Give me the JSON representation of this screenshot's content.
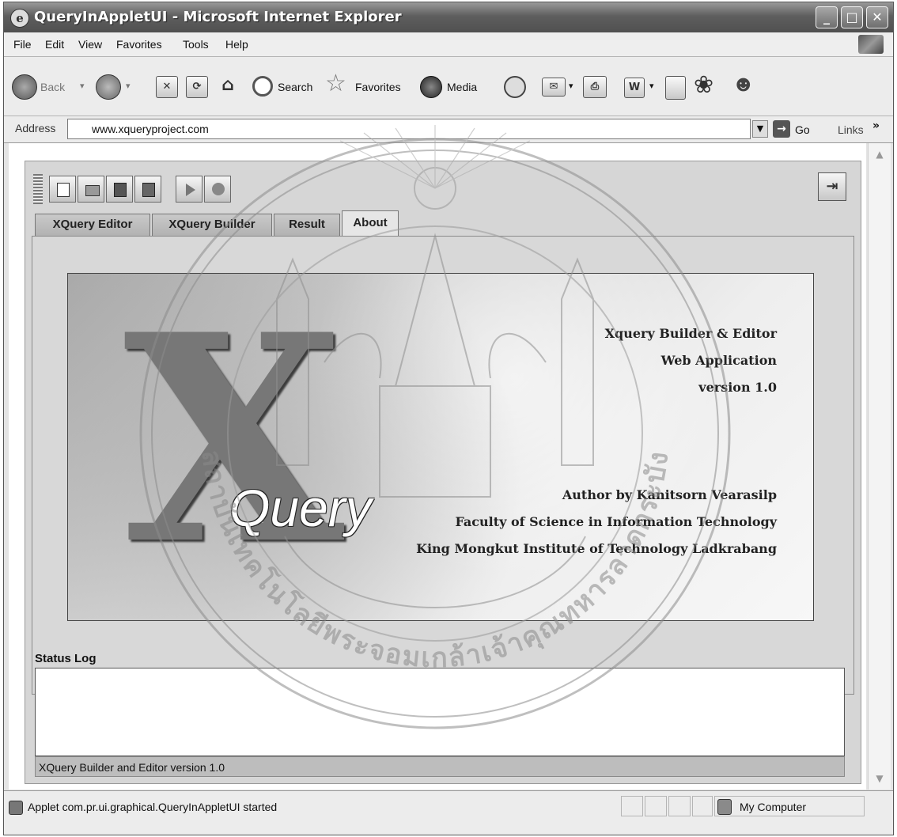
{
  "window": {
    "title": "QueryInAppletUI - Microsoft Internet Explorer",
    "controls": [
      "_",
      "□",
      "✕"
    ]
  },
  "menu": [
    "File",
    "Edit",
    "View",
    "Favorites",
    "Tools",
    "Help"
  ],
  "toolbar": {
    "back": "Back",
    "search": "Search",
    "favorites": "Favorites",
    "media": "Media"
  },
  "address": {
    "label": "Address",
    "url": "www.xqueryproject.com",
    "go": "Go",
    "links": "Links",
    "chevron": "»"
  },
  "applet": {
    "tabs": [
      "XQuery Editor",
      "XQuery Builder",
      "Result",
      "About"
    ],
    "active_tab": "About",
    "about": {
      "logo_letter": "X",
      "logo_word": "Query",
      "lines": [
        "Xquery Builder & Editor",
        "Web Application",
        "version  1.0",
        "Author by Kanitsorn Vearasilp",
        "Faculty of Science in Information Technology",
        "King Mongkut Institute of Technology Ladkrabang"
      ]
    },
    "status_log_label": "Status Log",
    "status_strip": "XQuery Builder and Editor version 1.0"
  },
  "watermark": {
    "text": "สถาบันเทคโนโลยีพระจอมเกล้าเจ้าคุณทหารลาดกระบัง"
  },
  "statusbar": {
    "text": "Applet com.pr.ui.graphical.QueryInAppletUI started",
    "zone": "My Computer"
  },
  "colors": {
    "titlebar": "#5e5e5e",
    "tab_active": "#e6e6e6",
    "tab_inactive": "#bdbdbd"
  }
}
